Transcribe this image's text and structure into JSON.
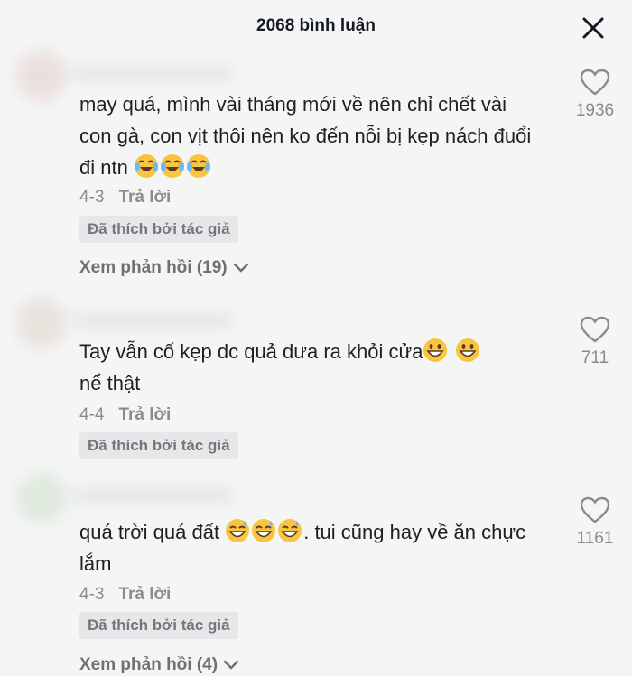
{
  "header": {
    "title": "2068 bình luận"
  },
  "comments": [
    {
      "text": "may quá, mình vài tháng mới về nên chỉ chết vài con gà, con vịt thôi nên ko đến nỗi bị kẹp nách đuổi đi ntn",
      "emojis": [
        "face-with-tears-of-joy-icon",
        "face-with-tears-of-joy-icon",
        "face-with-tears-of-joy-icon"
      ],
      "date": "4-3",
      "reply_label": "Trả lời",
      "badge": "Đã thích bởi tác giả",
      "view_replies": "Xem phản hồi (19)",
      "likes": "1936"
    },
    {
      "text": "Tay vẫn cố kẹp dc quả dưa ra khỏi cửa",
      "text_after": "nể thật",
      "emojis": [
        "grinning-face-icon",
        "grinning-face-icon"
      ],
      "date": "4-4",
      "reply_label": "Trả lời",
      "badge": "Đã thích bởi tác giả",
      "likes": "711"
    },
    {
      "text": "quá trời quá đất",
      "text_after": ". tui cũng hay về ăn chực lắm",
      "emojis": [
        "grinning-sweat-icon",
        "grinning-sweat-icon",
        "grinning-sweat-icon"
      ],
      "date": "4-3",
      "reply_label": "Trả lời",
      "badge": "Đã thích bởi tác giả",
      "view_replies": "Xem phản hồi (4)",
      "likes": "1161"
    }
  ]
}
